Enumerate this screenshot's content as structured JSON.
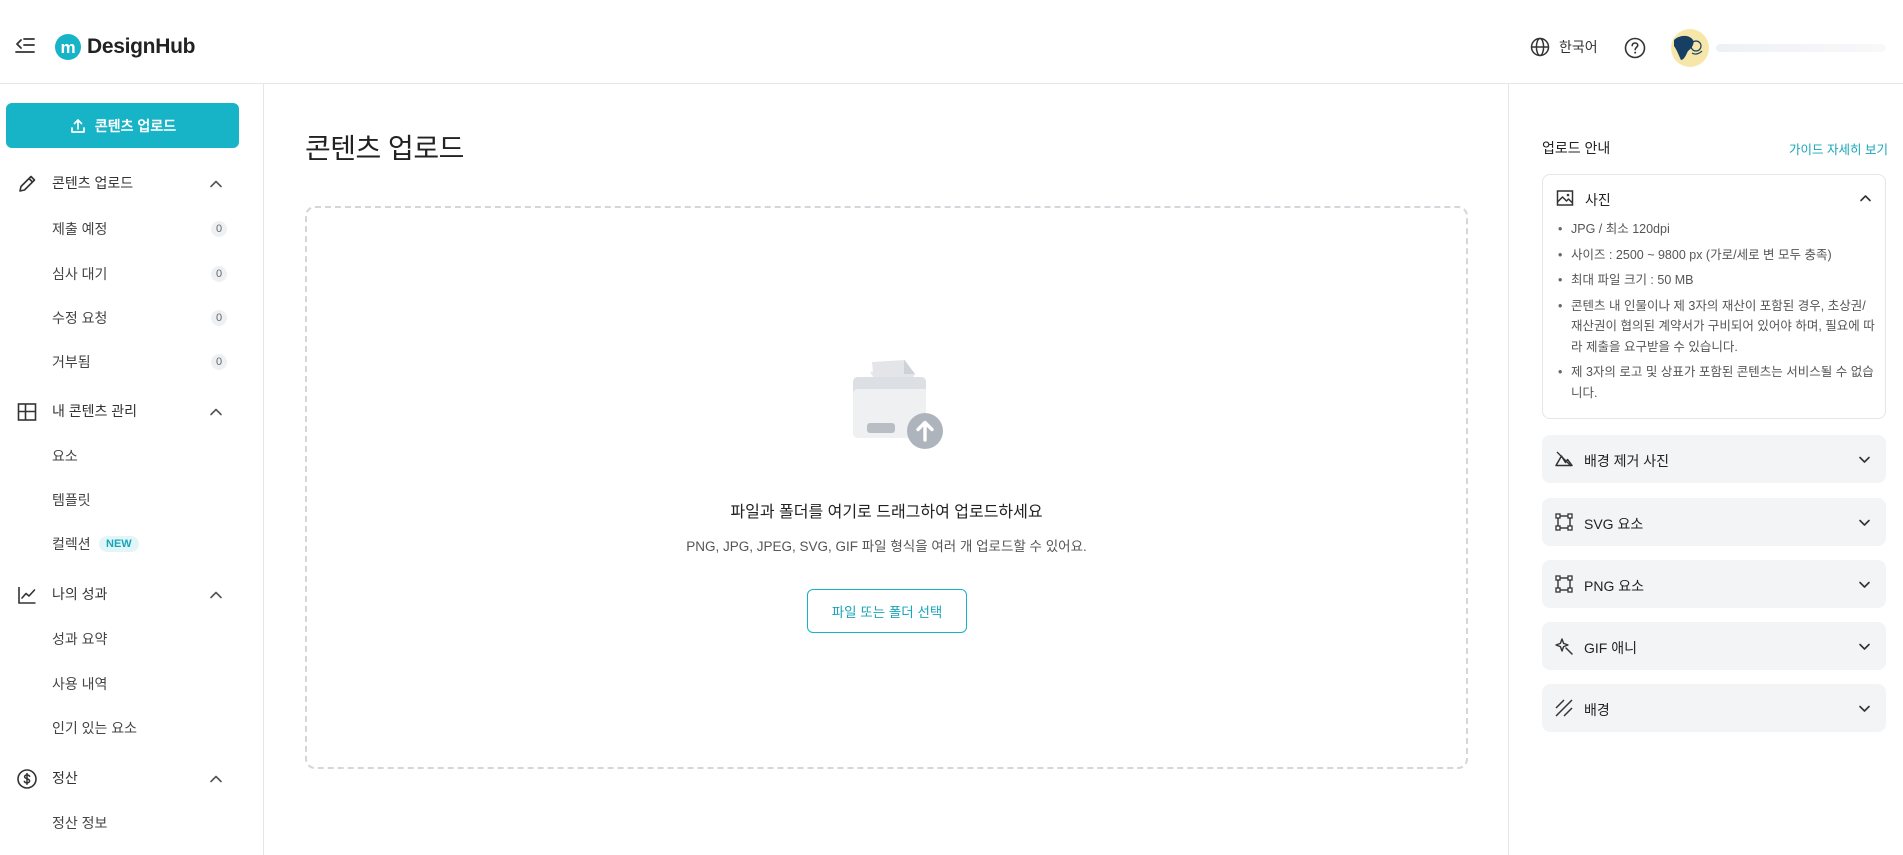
{
  "header": {
    "logo_letter": "m",
    "logo_text": "DesignHub",
    "language": "한국어"
  },
  "sidebar": {
    "upload_button": "콘텐츠 업로드",
    "sections": [
      {
        "label": "콘텐츠 업로드",
        "icon": "pencil-icon",
        "items": [
          {
            "label": "제출 예정",
            "count": "0"
          },
          {
            "label": "심사 대기",
            "count": "0"
          },
          {
            "label": "수정 요청",
            "count": "0"
          },
          {
            "label": "거부됨",
            "count": "0"
          }
        ]
      },
      {
        "label": "내 콘텐츠 관리",
        "icon": "layout-grid-icon",
        "items": [
          {
            "label": "요소"
          },
          {
            "label": "템플릿"
          },
          {
            "label": "컬렉션",
            "badge": "NEW"
          }
        ]
      },
      {
        "label": "나의 성과",
        "icon": "line-chart-icon",
        "items": [
          {
            "label": "성과 요약"
          },
          {
            "label": "사용 내역"
          },
          {
            "label": "인기 있는 요소"
          }
        ]
      },
      {
        "label": "정산",
        "icon": "dollar-coin-icon",
        "items": [
          {
            "label": "정산 정보"
          }
        ]
      }
    ]
  },
  "main": {
    "title": "콘텐츠 업로드",
    "dropzone": {
      "title": "파일과 폴더를 여기로 드래그하여 업로드하세요",
      "subtitle": "PNG, JPG, JPEG, SVG, GIF 파일 형식을 여러 개 업로드할 수 있어요.",
      "button": "파일 또는 폴더 선택"
    }
  },
  "guide": {
    "title": "업로드 안내",
    "link": "가이드 자세히 보기",
    "photo": {
      "label": "사진",
      "rules": [
        "JPG / 최소 120dpi",
        "사이즈 : 2500 ~ 9800 px (가로/세로 변 모두 충족)",
        "최대 파일 크기 : 50 MB",
        "콘텐츠 내 인물이나 제 3자의 재산이 포함된 경우, 초상권/재산권이 협의된 계약서가 구비되어 있어야 하며, 필요에 따라 제출을 요구받을 수 있습니다.",
        "제 3자의 로고 및 상표가 포함된 콘텐츠는 서비스될 수 없습니다."
      ]
    },
    "sections": [
      {
        "label": "배경 제거 사진",
        "icon": "mountain-icon"
      },
      {
        "label": "SVG 요소",
        "icon": "vector-frame-icon"
      },
      {
        "label": "PNG 요소",
        "icon": "vector-frame-icon"
      },
      {
        "label": "GIF 애니",
        "icon": "sparkle-icon"
      },
      {
        "label": "배경",
        "icon": "hatch-pattern-icon"
      }
    ]
  },
  "colors": {
    "accent": "#17b3c7",
    "accent_text": "#17a5b8",
    "border": "#e6e6e6",
    "panel_bg": "#f3f4f6"
  }
}
